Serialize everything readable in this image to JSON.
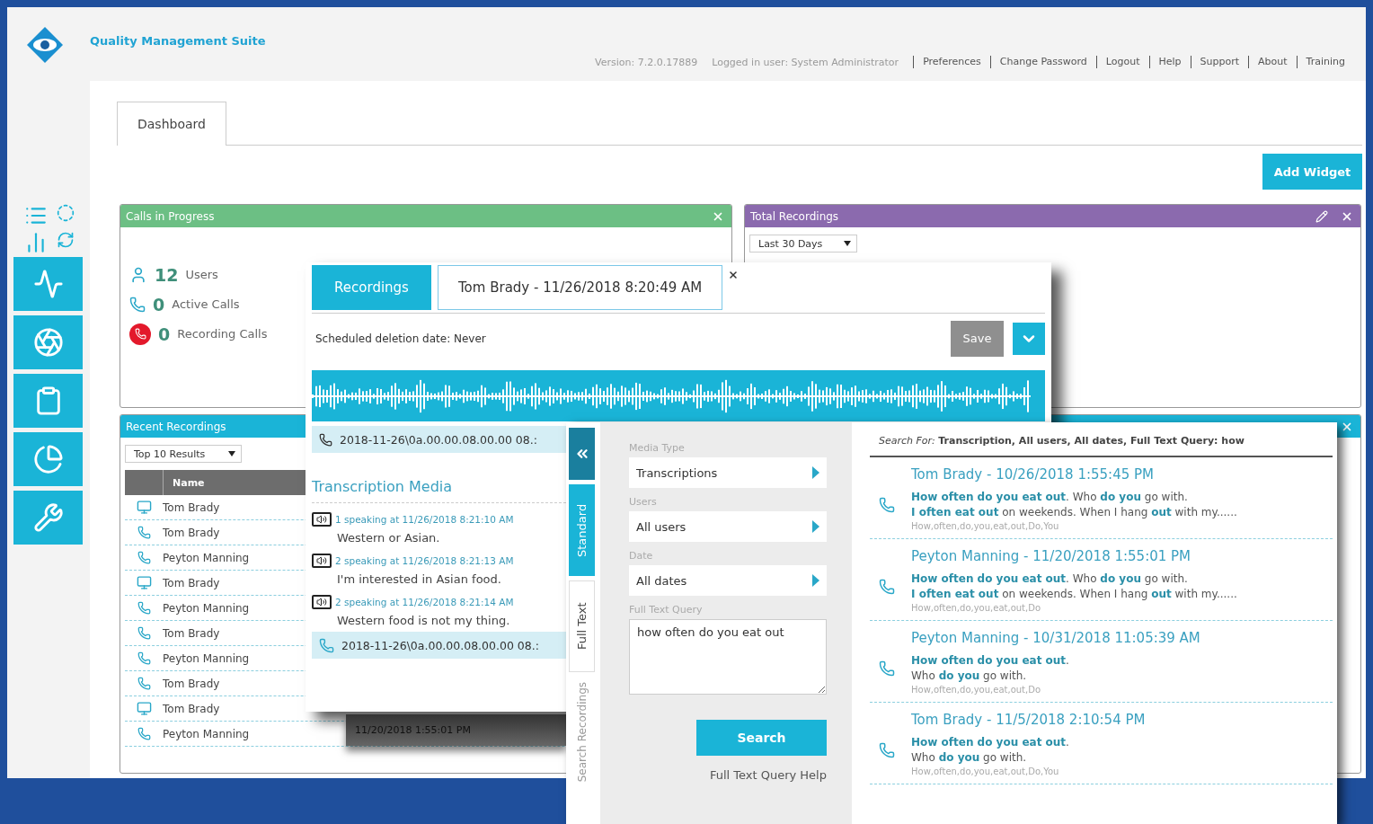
{
  "header": {
    "title": "Quality Management Suite",
    "version": "Version: 7.2.0.17889",
    "user": "Logged in user: System Administrator",
    "links": [
      "Preferences",
      "Change Password",
      "Logout",
      "Help",
      "Support",
      "About",
      "Training"
    ]
  },
  "tabs": [
    {
      "label": "Dashboard",
      "selected": true
    }
  ],
  "add_widget": "Add Widget",
  "calls_widget": {
    "title": "Calls in Progress",
    "stats": [
      {
        "kind": "users",
        "count": "12",
        "label": "Users"
      },
      {
        "kind": "active",
        "count": "0",
        "label": "Active Calls"
      },
      {
        "kind": "recording",
        "count": "0",
        "label": "Recording Calls"
      }
    ]
  },
  "total_widget": {
    "title": "Total Recordings",
    "range": "Last 30 Days"
  },
  "recent_widget": {
    "title": "Recent Recordings",
    "filter": "Top 10 Results",
    "column": "Name",
    "rows": [
      {
        "kind": "screen",
        "name": "Tom Brady"
      },
      {
        "kind": "call",
        "name": "Tom Brady"
      },
      {
        "kind": "call",
        "name": "Peyton Manning"
      },
      {
        "kind": "screen",
        "name": "Tom Brady"
      },
      {
        "kind": "call",
        "name": "Peyton Manning"
      },
      {
        "kind": "call",
        "name": "Tom Brady"
      },
      {
        "kind": "call",
        "name": "Peyton Manning"
      },
      {
        "kind": "call",
        "name": "Tom Brady"
      },
      {
        "kind": "screen",
        "name": "Tom Brady"
      },
      {
        "kind": "call",
        "name": "Peyton Manning"
      }
    ]
  },
  "recording_window": {
    "tabs": [
      {
        "label": "Recordings",
        "selected": false
      },
      {
        "label": "Tom Brady - 11/26/2018 8:20:49 AM",
        "selected": true
      }
    ],
    "deletion": "Scheduled deletion date: Never",
    "save": {
      "label": "Save",
      "disabled": true
    },
    "recordings": [
      {
        "kind": "call",
        "label": "2018-11-26\\0a.00.00.08.00.00 08.:",
        "transcription": {
          "title": "Transcription Media",
          "entries": [
            {
              "speaker": "1 speaking at 11/26/2018 8:21:10 AM",
              "text": "Western or Asian."
            },
            {
              "speaker": "2 speaking at 11/26/2018 8:21:13 AM",
              "text": "I'm interested in Asian food."
            },
            {
              "speaker": "2 speaking at 11/26/2018 8:21:14 AM",
              "text": "Western food is not my thing."
            }
          ]
        }
      },
      {
        "kind": "phone",
        "label": "2018-11-26\\0a.00.00.08.00.00 08.:"
      }
    ],
    "caption": "11/20/2018 1:55:01 PM"
  },
  "search_panel": {
    "tabs": [
      {
        "label": "Standard",
        "selected": false
      },
      {
        "label": "Full Text",
        "selected": true
      }
    ],
    "title": "Search Recordings",
    "fields": [
      {
        "kind": "select",
        "label": "Media Type",
        "value": "Transcriptions"
      },
      {
        "kind": "select",
        "label": "Users",
        "value": "All users"
      },
      {
        "kind": "select",
        "label": "Date",
        "value": "All dates"
      },
      {
        "kind": "textarea",
        "label": "Full Text Query",
        "value": "how often do you eat out"
      }
    ],
    "search_button": "Search",
    "help": "Full Text Query Help",
    "summary": "*Search For:* **Transcription, All users, All dates, Full Text Query: how**",
    "results": [
      {
        "title": "Tom Brady - 10/26/2018 1:55:45 PM",
        "lines": [
          "**How often do you eat out**. Who **do you** go with.",
          "**I often eat out** on weekends. When I hang **out** with my......"
        ],
        "keywords": "How,often,do,you,eat,out,Do,You"
      },
      {
        "title": "Peyton Manning - 11/20/2018 1:55:01 PM",
        "lines": [
          "**How often do you eat out**. Who **do you** go with.",
          "**I often eat out** on weekends. When I hang **out** with my......"
        ],
        "keywords": "How,often,do,you,eat,out,Do"
      },
      {
        "title": "Peyton Manning - 10/31/2018 11:05:39 AM",
        "lines": [
          "**How often do you eat out**.",
          "Who **do you** go with."
        ],
        "keywords": "How,often,do,you,eat,out,Do"
      },
      {
        "title": "Tom Brady - 11/5/2018 2:10:54 PM",
        "lines": [
          "**How often do you eat out**.",
          "Who **do you** go with."
        ],
        "keywords": "How,often,do,you,eat,out,Do,You"
      }
    ]
  }
}
